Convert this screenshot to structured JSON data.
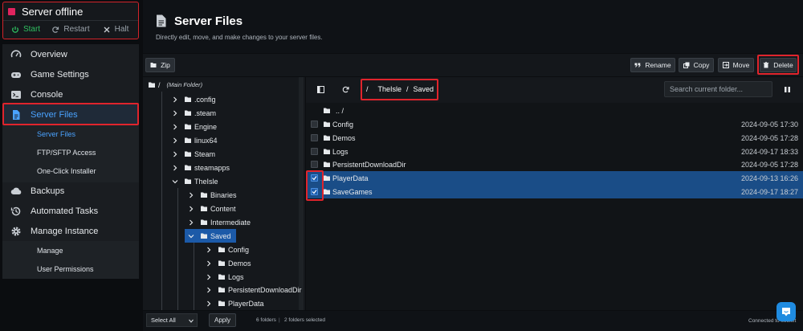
{
  "server": {
    "status": "Server offline",
    "start": "Start",
    "restart": "Restart",
    "halt": "Halt"
  },
  "nav": {
    "overview": "Overview",
    "game_settings": "Game Settings",
    "console": "Console",
    "server_files": "Server Files",
    "sub_server_files": "Server Files",
    "sub_ftp": "FTP/SFTP Access",
    "sub_installer": "One-Click Installer",
    "backups": "Backups",
    "automated_tasks": "Automated Tasks",
    "manage_instance": "Manage Instance",
    "sub_manage": "Manage",
    "sub_permissions": "User Permissions"
  },
  "header": {
    "title": "Server Files",
    "subtitle": "Directly edit, move, and make changes to your server files."
  },
  "toolbar": {
    "zip": "Zip",
    "rename": "Rename",
    "copy": "Copy",
    "move": "Move",
    "delete": "Delete"
  },
  "tree": {
    "root": "/",
    "root_label": "(Main Folder)",
    "items": [
      ".config",
      ".steam",
      "Engine",
      "linux64",
      "Steam",
      "steamapps",
      "TheIsle"
    ],
    "isle_children": [
      "Binaries",
      "Content",
      "Intermediate",
      "Saved"
    ],
    "saved_children": [
      "Config",
      "Demos",
      "Logs",
      "PersistentDownloadDir",
      "PlayerData"
    ]
  },
  "breadcrumb": {
    "sep1": "/",
    "part1": "TheIsle",
    "sep2": "/",
    "part2": "Saved"
  },
  "search": {
    "placeholder": "Search current folder..."
  },
  "files": {
    "parent": ".. /",
    "rows": [
      {
        "name": "Config",
        "date": "2024-09-05 17:30"
      },
      {
        "name": "Demos",
        "date": "2024-09-05 17:28"
      },
      {
        "name": "Logs",
        "date": "2024-09-17 18:33"
      },
      {
        "name": "PersistentDownloadDir",
        "date": "2024-09-05 17:28"
      },
      {
        "name": "PlayerData",
        "date": "2024-09-13 16:26"
      },
      {
        "name": "SaveGames",
        "date": "2024-09-17 18:27"
      }
    ]
  },
  "footer": {
    "select_all": "Select All",
    "apply": "Apply",
    "folders": "6 folders",
    "selected": "2 folders selected",
    "connected": "Connected to socket"
  },
  "colors": {
    "accent": "#4aa3ff",
    "highlight": "#e0242c",
    "selected_row": "#1a4d87",
    "start_green": "#2fbf60"
  }
}
